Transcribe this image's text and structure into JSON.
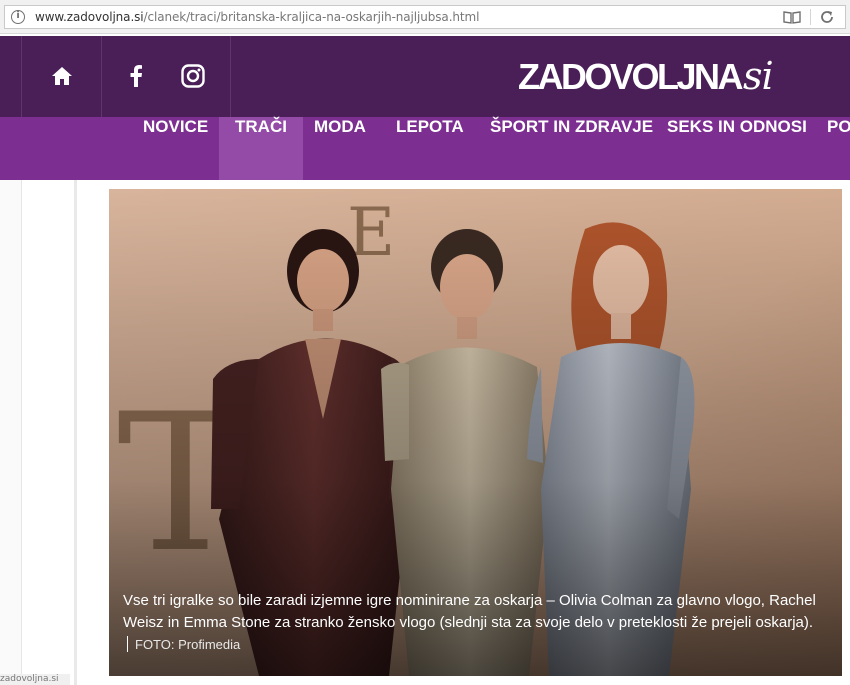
{
  "browser": {
    "url_host": "www.zadovoljna.si",
    "url_path": "/clanek/traci/britanska-kraljica-na-oskarjih-najljubsa.html",
    "info_icon": "info-icon",
    "reader_icon": "reader-mode-icon",
    "reload_icon": "reload-icon",
    "status_url": "zadovoljna.si"
  },
  "header": {
    "logo_main": "ZADOVOLJNA",
    "logo_suffix": "si",
    "home_icon": "home-icon",
    "facebook_icon": "facebook-icon",
    "instagram_icon": "instagram-icon",
    "colors": {
      "top": "#4a1f58",
      "nav": "#7c2f91",
      "nav_active": "#944ba7"
    }
  },
  "nav": {
    "items": [
      {
        "label": "NOVICE"
      },
      {
        "label": "TRAČI",
        "active": true
      },
      {
        "label": "MODA"
      },
      {
        "label": "LEPOTA"
      },
      {
        "label": "ŠPORT IN ZDRAVJE"
      },
      {
        "label": "SEKS IN ODNOSI"
      },
      {
        "label": "PO"
      }
    ]
  },
  "article": {
    "photo_letters": [
      "E",
      "T"
    ],
    "caption": "Vse tri igralke so bile zaradi izjemne igre nominirane za oskarja – Olivia Colman za glavno vlogo, Rachel Weisz in Emma Stone za stranko žensko vlogo (slednji sta za svoje delo v preteklosti že prejeli oskarja).",
    "credit": "FOTO: Profimedia"
  }
}
